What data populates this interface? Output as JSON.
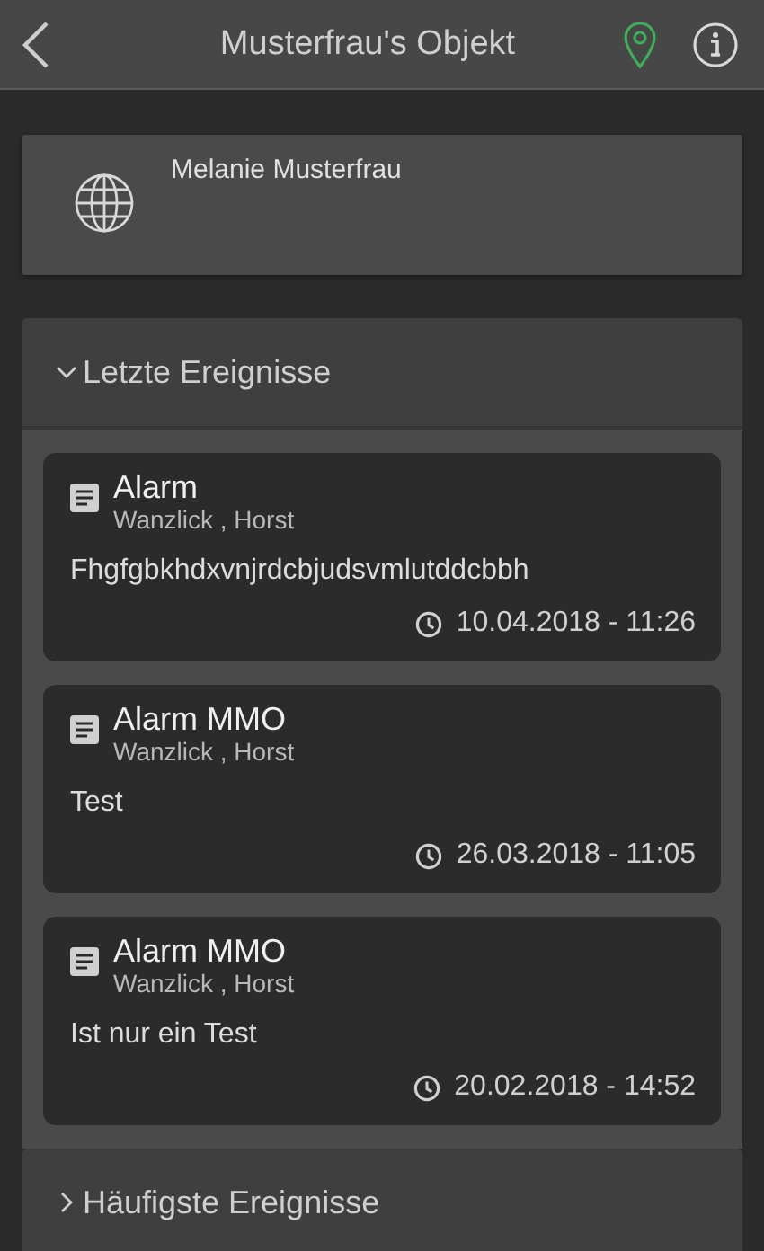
{
  "header": {
    "title": "Musterfrau's Objekt"
  },
  "contact": {
    "name": "Melanie Musterfrau"
  },
  "sections": [
    {
      "title": "Letzte Ereignisse",
      "expanded": true,
      "events": [
        {
          "title": "Alarm",
          "person": "Wanzlick , Horst",
          "text": "Fhgfgbkhdxvnjrdcbjudsvmlutddcbbh",
          "time": "10.04.2018 - 11:26"
        },
        {
          "title": "Alarm MMO",
          "person": "Wanzlick , Horst",
          "text": "Test",
          "time": "26.03.2018 - 11:05"
        },
        {
          "title": "Alarm MMO",
          "person": "Wanzlick , Horst",
          "text": "Ist nur ein Test",
          "time": "20.02.2018 - 14:52"
        }
      ]
    },
    {
      "title": "Häufigste Ereignisse",
      "expanded": false
    }
  ]
}
